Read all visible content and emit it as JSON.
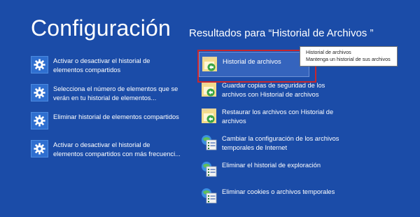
{
  "header": {
    "title": "Configuración",
    "results_label": "Resultados para “Historial de Archivos ”"
  },
  "settings_results": [
    {
      "line1": "Activar o desactivar el historial de",
      "line2": "elementos compartidos",
      "icon": "gear-icon"
    },
    {
      "line1": "Selecciona el número de elementos que se",
      "line2": "verán en tu historial de elementos...",
      "icon": "gear-icon"
    },
    {
      "line1": "Eliminar historial de elementos compartidos",
      "line2": "",
      "icon": "gear-icon"
    },
    {
      "line1": "Activar o desactivar el historial de",
      "line2": "elementos compartidos con más frecuenci...",
      "icon": "gear-icon"
    }
  ],
  "control_panel_results": [
    {
      "line1": "Historial de archivos",
      "line2": "",
      "icon": "file-history-icon",
      "selected": true
    },
    {
      "line1": "Guardar copias de seguridad de los",
      "line2": "archivos con Historial de archivos",
      "icon": "file-history-icon"
    },
    {
      "line1": "Restaurar los archivos con Historial de",
      "line2": "archivos",
      "icon": "file-history-icon"
    },
    {
      "line1": "Cambiar la configuración de los archivos",
      "line2": "temporales de Internet",
      "icon": "internet-options-icon"
    },
    {
      "line1": "Eliminar el historial de exploración",
      "line2": "",
      "icon": "internet-options-icon"
    },
    {
      "line1": "Eliminar cookies o archivos temporales",
      "line2": "",
      "icon": "internet-options-icon"
    }
  ],
  "tooltip": {
    "line1": "Historial de archivos",
    "line2": "Mantenga un historial de sus archivos"
  },
  "colors": {
    "background": "#1b4ca8",
    "highlight_border": "#c8262d",
    "selected_bg": "#3564bd"
  }
}
